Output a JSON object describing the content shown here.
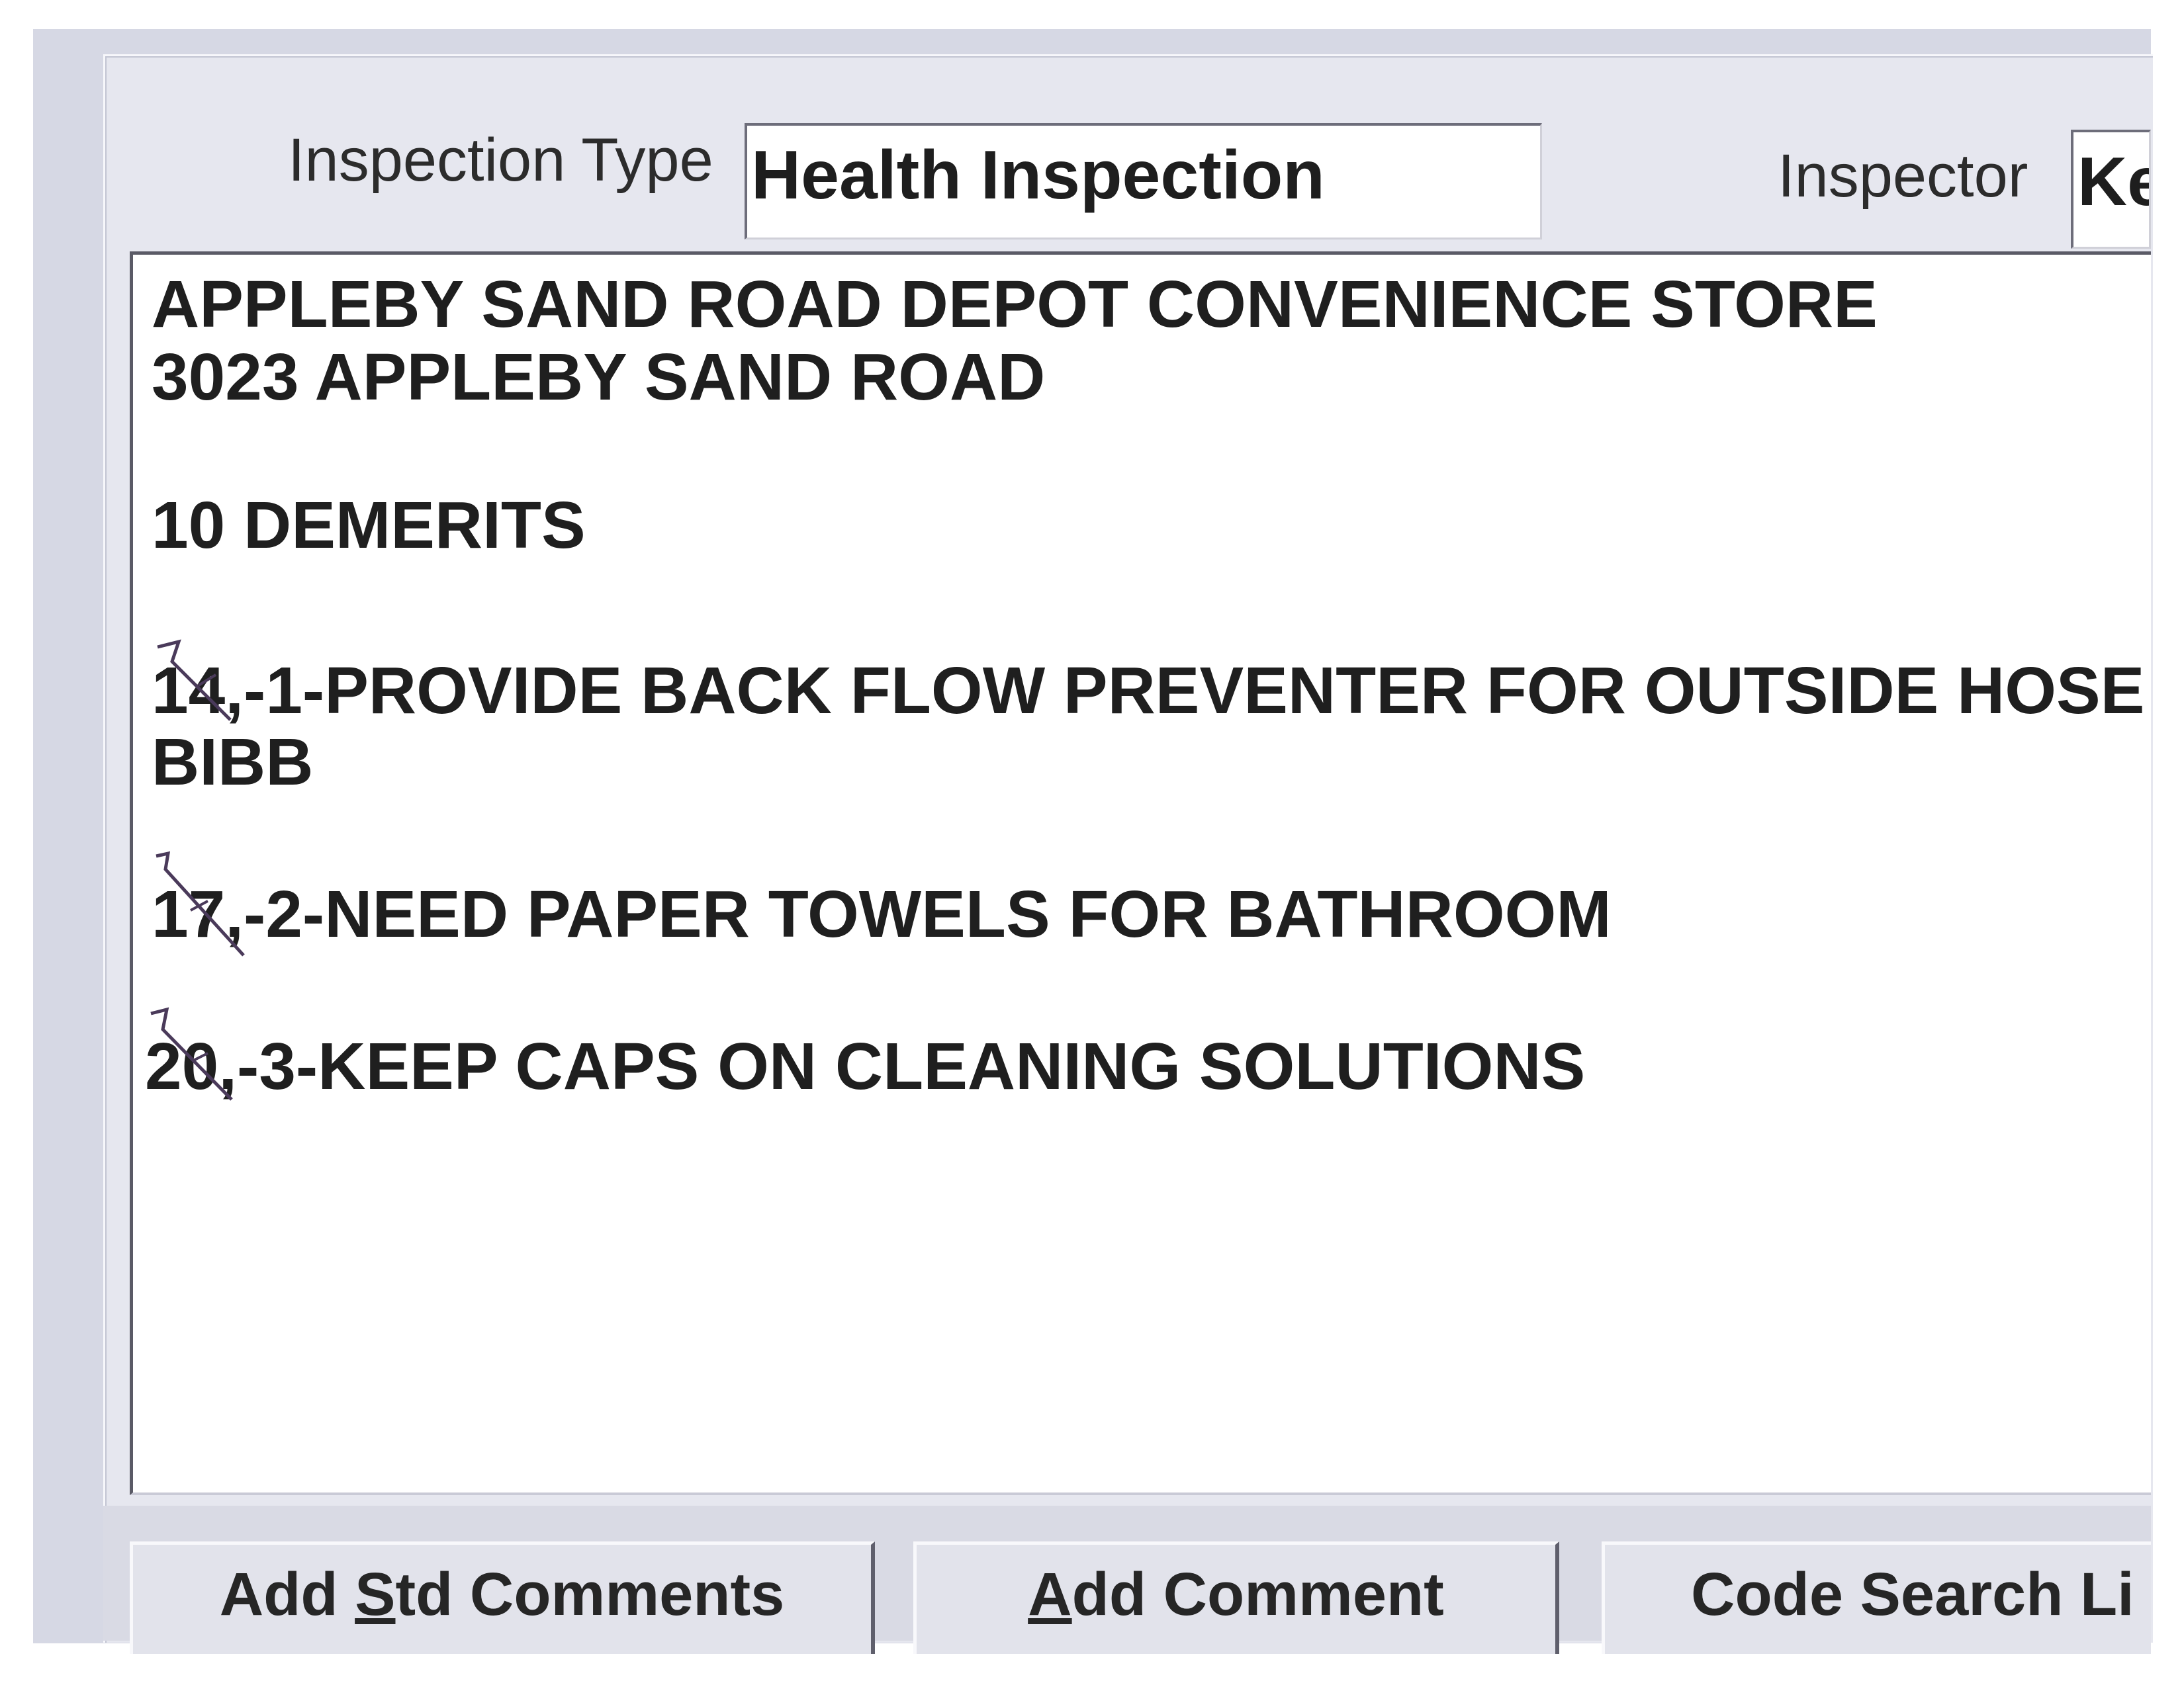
{
  "header": {
    "inspection_type_label": "Inspection Type",
    "inspection_type_value": "Health Inspection",
    "inspector_label": "Inspector",
    "inspector_value": "Ke"
  },
  "comments": {
    "lines": [
      "APPLEBY SAND ROAD DEPOT CONVENIENCE STORE",
      "3023 APPLEBY SAND ROAD",
      "10 DEMERITS",
      "14,-1-PROVIDE BACK FLOW PREVENTER FOR OUTSIDE HOSE",
      "BIBB",
      "17,-2-NEED PAPER TOWELS FOR BATHROOM",
      "20,-3-KEEP CAPS ON CLEANING  SOLUTIONS"
    ]
  },
  "buttons": {
    "add_std_comments": {
      "prefix": "Add ",
      "mnemonic": "S",
      "suffix": "td Comments"
    },
    "add_comment": {
      "prefix": "",
      "mnemonic": "A",
      "suffix": "dd Comment"
    },
    "code_search": {
      "label": "Code Search Li"
    }
  },
  "colors": {
    "panel": "#d6d8e4",
    "frame": "#e6e7ef",
    "text_area": "#ffffff",
    "handwriting": "#4a3a5a"
  },
  "icons": {
    "handwritten_strike": "pen-strike-mark"
  }
}
